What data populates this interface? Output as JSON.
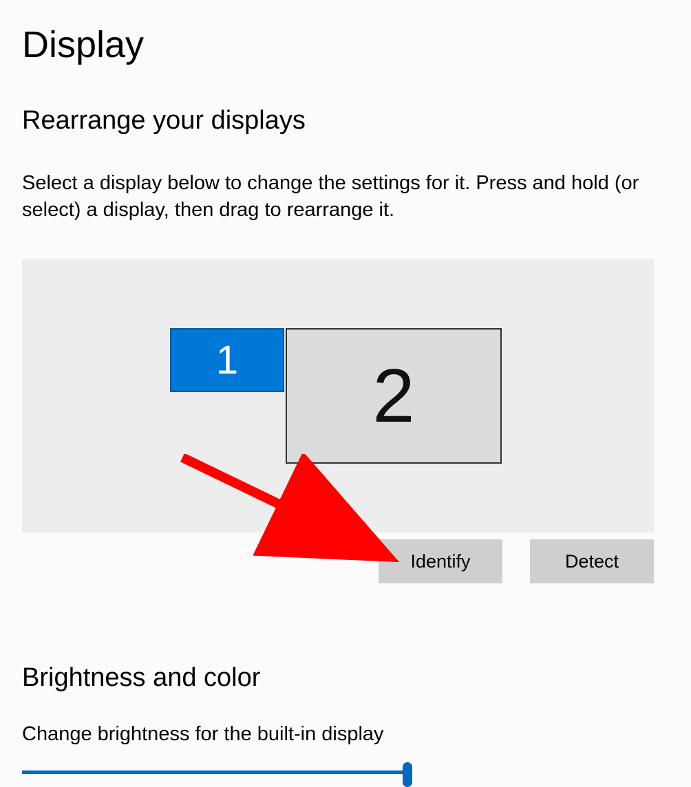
{
  "page": {
    "title": "Display"
  },
  "rearrange": {
    "title": "Rearrange your displays",
    "description": "Select a display below to change the settings for it. Press and hold (or select) a display, then drag to rearrange it.",
    "displays": [
      {
        "id": "1",
        "selected": true
      },
      {
        "id": "2",
        "selected": false
      }
    ],
    "identify_label": "Identify",
    "detect_label": "Detect"
  },
  "brightness": {
    "title": "Brightness and color",
    "label": "Change brightness for the built-in display",
    "value_percent": 100
  },
  "colors": {
    "accent": "#0078d7",
    "slider": "#0067c0"
  }
}
